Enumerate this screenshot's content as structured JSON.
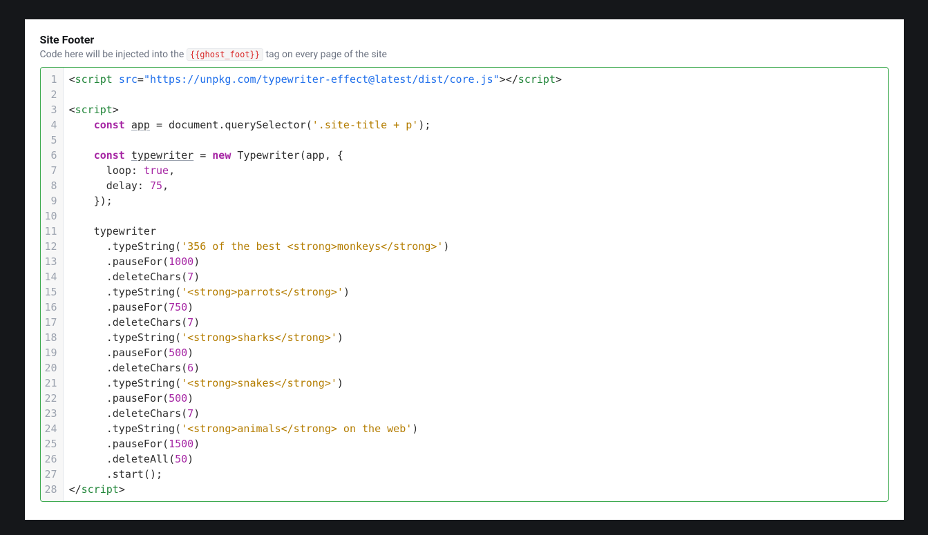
{
  "section": {
    "title": "Site Footer",
    "description_pre": "Code here will be injected into the ",
    "description_code": "{{ghost_foot}}",
    "description_post": " tag on every page of the site"
  },
  "editor": {
    "lines": [
      {
        "n": "1",
        "t": [
          {
            "c": "tok-punct",
            "s": "<"
          },
          {
            "c": "tok-tag",
            "s": "script"
          },
          {
            "c": "",
            "s": " "
          },
          {
            "c": "tok-attr",
            "s": "src"
          },
          {
            "c": "tok-punct",
            "s": "="
          },
          {
            "c": "tok-str",
            "s": "\"https://unpkg.com/typewriter-effect@latest/dist/core.js\""
          },
          {
            "c": "tok-punct",
            "s": ">"
          },
          {
            "c": "tok-punct",
            "s": "</"
          },
          {
            "c": "tok-tag",
            "s": "script"
          },
          {
            "c": "tok-punct",
            "s": ">"
          }
        ]
      },
      {
        "n": "2",
        "t": []
      },
      {
        "n": "3",
        "t": [
          {
            "c": "tok-punct",
            "s": "<"
          },
          {
            "c": "tok-tag",
            "s": "script"
          },
          {
            "c": "tok-punct",
            "s": ">"
          }
        ]
      },
      {
        "n": "4",
        "t": [
          {
            "c": "",
            "s": "    "
          },
          {
            "c": "tok-kw",
            "s": "const"
          },
          {
            "c": "",
            "s": " "
          },
          {
            "c": "tok-var",
            "s": "app"
          },
          {
            "c": "",
            "s": " "
          },
          {
            "c": "tok-punct",
            "s": "="
          },
          {
            "c": "",
            "s": " document"
          },
          {
            "c": "tok-punct",
            "s": "."
          },
          {
            "c": "",
            "s": "querySelector"
          },
          {
            "c": "tok-punct",
            "s": "("
          },
          {
            "c": "tok-strlit",
            "s": "'.site-title + p'"
          },
          {
            "c": "tok-punct",
            "s": ");"
          }
        ]
      },
      {
        "n": "5",
        "t": []
      },
      {
        "n": "6",
        "t": [
          {
            "c": "",
            "s": "    "
          },
          {
            "c": "tok-kw",
            "s": "const"
          },
          {
            "c": "",
            "s": " "
          },
          {
            "c": "tok-var",
            "s": "typewriter"
          },
          {
            "c": "",
            "s": " "
          },
          {
            "c": "tok-punct",
            "s": "="
          },
          {
            "c": "",
            "s": " "
          },
          {
            "c": "tok-kw",
            "s": "new"
          },
          {
            "c": "",
            "s": " Typewriter"
          },
          {
            "c": "tok-punct",
            "s": "("
          },
          {
            "c": "",
            "s": "app"
          },
          {
            "c": "tok-punct",
            "s": ","
          },
          {
            "c": "",
            "s": " "
          },
          {
            "c": "tok-punct",
            "s": "{"
          }
        ]
      },
      {
        "n": "7",
        "t": [
          {
            "c": "",
            "s": "      loop"
          },
          {
            "c": "tok-punct",
            "s": ":"
          },
          {
            "c": "",
            "s": " "
          },
          {
            "c": "tok-bool",
            "s": "true"
          },
          {
            "c": "tok-punct",
            "s": ","
          }
        ]
      },
      {
        "n": "8",
        "t": [
          {
            "c": "",
            "s": "      delay"
          },
          {
            "c": "tok-punct",
            "s": ":"
          },
          {
            "c": "",
            "s": " "
          },
          {
            "c": "tok-num",
            "s": "75"
          },
          {
            "c": "tok-punct",
            "s": ","
          }
        ]
      },
      {
        "n": "9",
        "t": [
          {
            "c": "",
            "s": "    "
          },
          {
            "c": "tok-punct",
            "s": "});"
          }
        ]
      },
      {
        "n": "10",
        "t": []
      },
      {
        "n": "11",
        "t": [
          {
            "c": "",
            "s": "    typewriter"
          }
        ]
      },
      {
        "n": "12",
        "t": [
          {
            "c": "",
            "s": "      "
          },
          {
            "c": "tok-punct",
            "s": "."
          },
          {
            "c": "",
            "s": "typeString"
          },
          {
            "c": "tok-punct",
            "s": "("
          },
          {
            "c": "tok-strlit",
            "s": "'356 of the best <strong>monkeys</strong>'"
          },
          {
            "c": "tok-punct",
            "s": ")"
          }
        ]
      },
      {
        "n": "13",
        "t": [
          {
            "c": "",
            "s": "      "
          },
          {
            "c": "tok-punct",
            "s": "."
          },
          {
            "c": "",
            "s": "pauseFor"
          },
          {
            "c": "tok-punct",
            "s": "("
          },
          {
            "c": "tok-num",
            "s": "1000"
          },
          {
            "c": "tok-punct",
            "s": ")"
          }
        ]
      },
      {
        "n": "14",
        "t": [
          {
            "c": "",
            "s": "      "
          },
          {
            "c": "tok-punct",
            "s": "."
          },
          {
            "c": "",
            "s": "deleteChars"
          },
          {
            "c": "tok-punct",
            "s": "("
          },
          {
            "c": "tok-num",
            "s": "7"
          },
          {
            "c": "tok-punct",
            "s": ")"
          }
        ]
      },
      {
        "n": "15",
        "t": [
          {
            "c": "",
            "s": "      "
          },
          {
            "c": "tok-punct",
            "s": "."
          },
          {
            "c": "",
            "s": "typeString"
          },
          {
            "c": "tok-punct",
            "s": "("
          },
          {
            "c": "tok-strlit",
            "s": "'<strong>parrots</strong>'"
          },
          {
            "c": "tok-punct",
            "s": ")"
          }
        ]
      },
      {
        "n": "16",
        "t": [
          {
            "c": "",
            "s": "      "
          },
          {
            "c": "tok-punct",
            "s": "."
          },
          {
            "c": "",
            "s": "pauseFor"
          },
          {
            "c": "tok-punct",
            "s": "("
          },
          {
            "c": "tok-num",
            "s": "750"
          },
          {
            "c": "tok-punct",
            "s": ")"
          }
        ]
      },
      {
        "n": "17",
        "t": [
          {
            "c": "",
            "s": "      "
          },
          {
            "c": "tok-punct",
            "s": "."
          },
          {
            "c": "",
            "s": "deleteChars"
          },
          {
            "c": "tok-punct",
            "s": "("
          },
          {
            "c": "tok-num",
            "s": "7"
          },
          {
            "c": "tok-punct",
            "s": ")"
          }
        ]
      },
      {
        "n": "18",
        "t": [
          {
            "c": "",
            "s": "      "
          },
          {
            "c": "tok-punct",
            "s": "."
          },
          {
            "c": "",
            "s": "typeString"
          },
          {
            "c": "tok-punct",
            "s": "("
          },
          {
            "c": "tok-strlit",
            "s": "'<strong>sharks</strong>'"
          },
          {
            "c": "tok-punct",
            "s": ")"
          }
        ]
      },
      {
        "n": "19",
        "t": [
          {
            "c": "",
            "s": "      "
          },
          {
            "c": "tok-punct",
            "s": "."
          },
          {
            "c": "",
            "s": "pauseFor"
          },
          {
            "c": "tok-punct",
            "s": "("
          },
          {
            "c": "tok-num",
            "s": "500"
          },
          {
            "c": "tok-punct",
            "s": ")"
          }
        ]
      },
      {
        "n": "20",
        "t": [
          {
            "c": "",
            "s": "      "
          },
          {
            "c": "tok-punct",
            "s": "."
          },
          {
            "c": "",
            "s": "deleteChars"
          },
          {
            "c": "tok-punct",
            "s": "("
          },
          {
            "c": "tok-num",
            "s": "6"
          },
          {
            "c": "tok-punct",
            "s": ")"
          }
        ]
      },
      {
        "n": "21",
        "t": [
          {
            "c": "",
            "s": "      "
          },
          {
            "c": "tok-punct",
            "s": "."
          },
          {
            "c": "",
            "s": "typeString"
          },
          {
            "c": "tok-punct",
            "s": "("
          },
          {
            "c": "tok-strlit",
            "s": "'<strong>snakes</strong>'"
          },
          {
            "c": "tok-punct",
            "s": ")"
          }
        ]
      },
      {
        "n": "22",
        "t": [
          {
            "c": "",
            "s": "      "
          },
          {
            "c": "tok-punct",
            "s": "."
          },
          {
            "c": "",
            "s": "pauseFor"
          },
          {
            "c": "tok-punct",
            "s": "("
          },
          {
            "c": "tok-num",
            "s": "500"
          },
          {
            "c": "tok-punct",
            "s": ")"
          }
        ]
      },
      {
        "n": "23",
        "t": [
          {
            "c": "",
            "s": "      "
          },
          {
            "c": "tok-punct",
            "s": "."
          },
          {
            "c": "",
            "s": "deleteChars"
          },
          {
            "c": "tok-punct",
            "s": "("
          },
          {
            "c": "tok-num",
            "s": "7"
          },
          {
            "c": "tok-punct",
            "s": ")"
          }
        ]
      },
      {
        "n": "24",
        "t": [
          {
            "c": "",
            "s": "      "
          },
          {
            "c": "tok-punct",
            "s": "."
          },
          {
            "c": "",
            "s": "typeString"
          },
          {
            "c": "tok-punct",
            "s": "("
          },
          {
            "c": "tok-strlit",
            "s": "'<strong>animals</strong> on the web'"
          },
          {
            "c": "tok-punct",
            "s": ")"
          }
        ]
      },
      {
        "n": "25",
        "t": [
          {
            "c": "",
            "s": "      "
          },
          {
            "c": "tok-punct",
            "s": "."
          },
          {
            "c": "",
            "s": "pauseFor"
          },
          {
            "c": "tok-punct",
            "s": "("
          },
          {
            "c": "tok-num",
            "s": "1500"
          },
          {
            "c": "tok-punct",
            "s": ")"
          }
        ]
      },
      {
        "n": "26",
        "t": [
          {
            "c": "",
            "s": "      "
          },
          {
            "c": "tok-punct",
            "s": "."
          },
          {
            "c": "",
            "s": "deleteAll"
          },
          {
            "c": "tok-punct",
            "s": "("
          },
          {
            "c": "tok-num",
            "s": "50"
          },
          {
            "c": "tok-punct",
            "s": ")"
          }
        ]
      },
      {
        "n": "27",
        "t": [
          {
            "c": "",
            "s": "      "
          },
          {
            "c": "tok-punct",
            "s": "."
          },
          {
            "c": "",
            "s": "start"
          },
          {
            "c": "tok-punct",
            "s": "();"
          }
        ]
      },
      {
        "n": "28",
        "t": [
          {
            "c": "tok-punct",
            "s": "</"
          },
          {
            "c": "tok-tag",
            "s": "script"
          },
          {
            "c": "tok-punct",
            "s": ">"
          }
        ]
      }
    ]
  }
}
